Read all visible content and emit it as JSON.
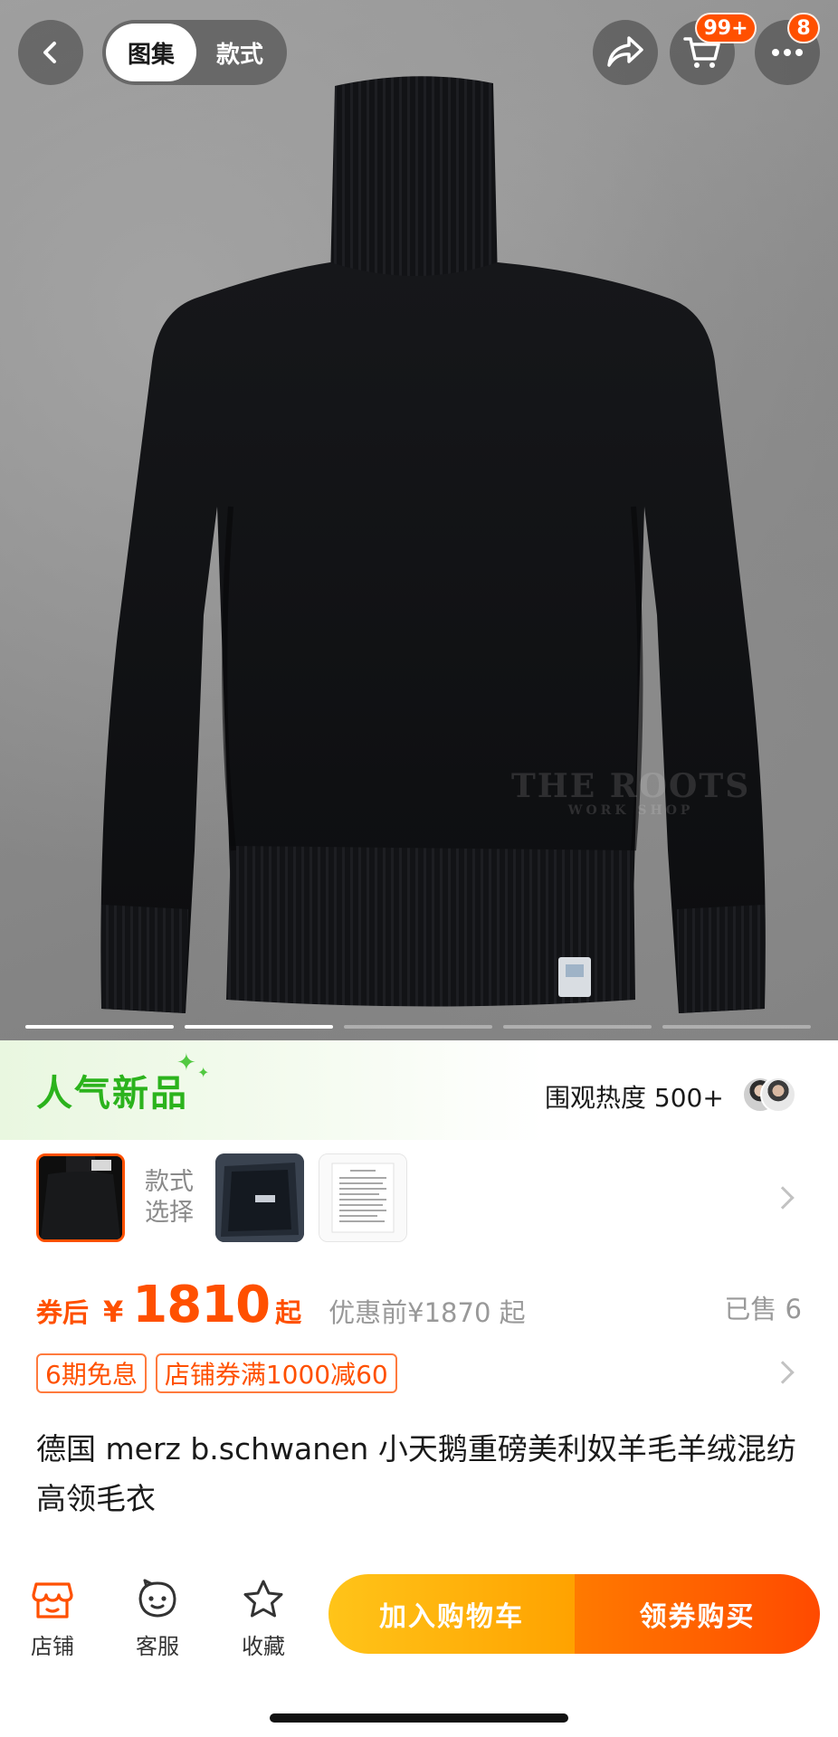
{
  "header": {
    "tabs": [
      {
        "label": "图集",
        "active": true
      },
      {
        "label": "款式",
        "active": false
      }
    ],
    "cart_badge": "99+",
    "more_badge": "8"
  },
  "gallery": {
    "watermark_line1": "THE ROOTS",
    "watermark_line2": "WORK SHOP",
    "page_count": 5,
    "active_page": 2
  },
  "promo": {
    "hot_label": "人气新品",
    "heat_text": "围观热度 500+"
  },
  "variants": {
    "label": "款式\n选择",
    "thumbnails": [
      "black-sweater-thumb",
      "packaged-thumb",
      "document-thumb"
    ],
    "selected_index": 0
  },
  "price": {
    "prefix": "券后",
    "currency": "¥",
    "amount": "1810",
    "suffix": "起",
    "original": "优惠前¥1870 起",
    "sold": "已售 6"
  },
  "tags": [
    "6期免息",
    "店铺券满1000减60"
  ],
  "product": {
    "title": "德国 merz b.schwanen 小天鹅重磅美利奴羊毛羊绒混纺高领毛衣"
  },
  "bottom_bar": {
    "shop": "店铺",
    "service": "客服",
    "favorite": "收藏",
    "add_to_cart": "加入购物车",
    "buy": "领券购买"
  },
  "colors": {
    "accent": "#ff5000",
    "hot_green": "#2bb31c",
    "cart_yellow": "#ffb300",
    "buy_orange": "#ff5a00"
  }
}
